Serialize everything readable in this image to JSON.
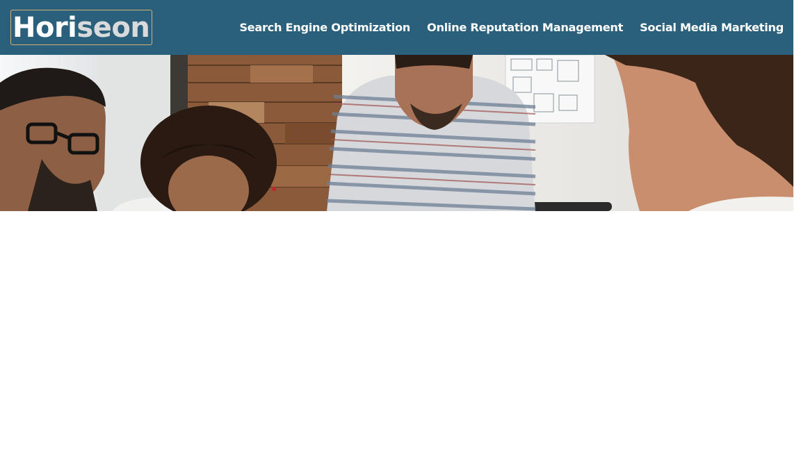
{
  "header": {
    "logo": {
      "part1": "Hori",
      "part2": "seon"
    },
    "nav": [
      {
        "label": "Search Engine Optimization"
      },
      {
        "label": "Online Reputation Management"
      },
      {
        "label": "Social Media Marketing"
      }
    ]
  },
  "colors": {
    "header_bg": "#2a607c",
    "logo_border": "#d9b071",
    "nav_text": "#ffffff",
    "logo_secondary": "#d9dadb",
    "page_bg": "#ffffff"
  },
  "hero": {
    "icon": "team-meeting-photo"
  }
}
